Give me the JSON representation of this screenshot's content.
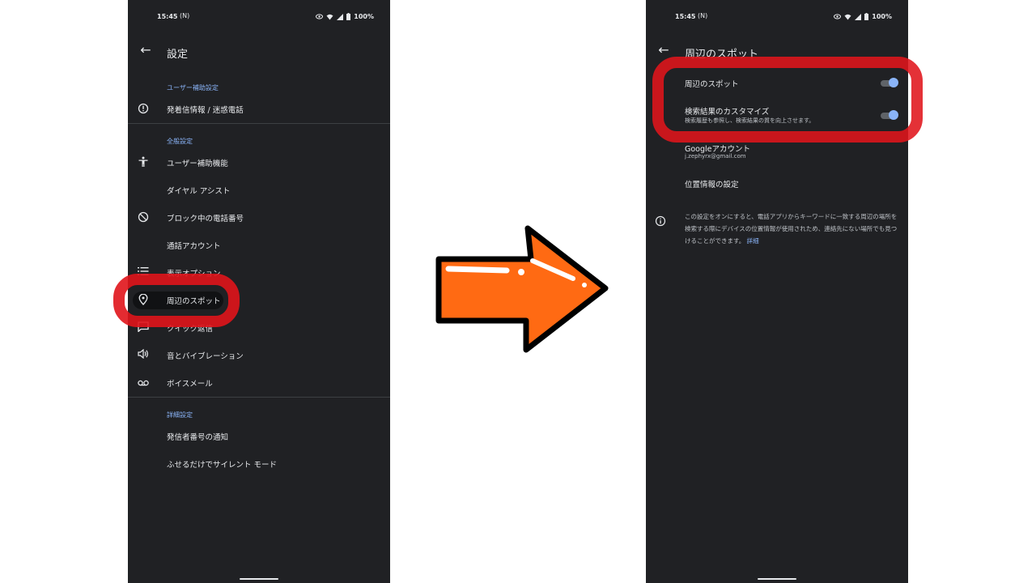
{
  "left_phone": {
    "status": {
      "time": "15:45",
      "nfc": "(N)",
      "battery": "100%"
    },
    "title": "設定",
    "sections": [
      {
        "header": "ユーザー補助設定",
        "items": [
          {
            "label": "発着信情報 / 迷惑電話",
            "icon": "info-circle-icon"
          }
        ]
      },
      {
        "header": "全般設定",
        "items": [
          {
            "label": "ユーザー補助機能",
            "icon": "accessibility-icon"
          },
          {
            "label": "ダイヤル アシスト",
            "icon": ""
          },
          {
            "label": "ブロック中の電話番号",
            "icon": "block-icon"
          },
          {
            "label": "通話アカウント",
            "icon": ""
          },
          {
            "label": "表示オプション",
            "icon": "list-icon"
          },
          {
            "label": "周辺のスポット",
            "icon": "location-pin-icon"
          },
          {
            "label": "クイック返信",
            "icon": "message-icon"
          },
          {
            "label": "音とバイブレーション",
            "icon": "volume-icon"
          },
          {
            "label": "ボイスメール",
            "icon": "voicemail-icon"
          }
        ]
      },
      {
        "header": "詳細設定",
        "items": [
          {
            "label": "発信者番号の通知",
            "icon": ""
          },
          {
            "label": "ふせるだけでサイレント モード",
            "icon": ""
          }
        ]
      }
    ]
  },
  "right_phone": {
    "status": {
      "time": "15:45",
      "nfc": "(N)",
      "battery": "100%"
    },
    "title": "周辺のスポット",
    "nearby_toggle": {
      "label": "周辺のスポット",
      "on": true
    },
    "search_toggle": {
      "label": "検索結果のカスタマイズ",
      "sub": "検索履歴も参照し、検索結果の質を向上させます。",
      "on": true
    },
    "account": {
      "label": "Googleアカウント",
      "email": "j.zephyrx@gmail.com"
    },
    "location": {
      "label": "位置情報の設定"
    },
    "info": {
      "text": "この設定をオンにすると、電話アプリからキーワードに一致する周辺の場所を検索する際にデバイスの位置情報が使用されため、連絡先にない場所でも見つけることができます。",
      "link": "詳細"
    }
  },
  "colors": {
    "background": "#202124",
    "accent": "#8ab4f8",
    "highlight": "#e0141b",
    "arrow": "#ff6a13"
  }
}
